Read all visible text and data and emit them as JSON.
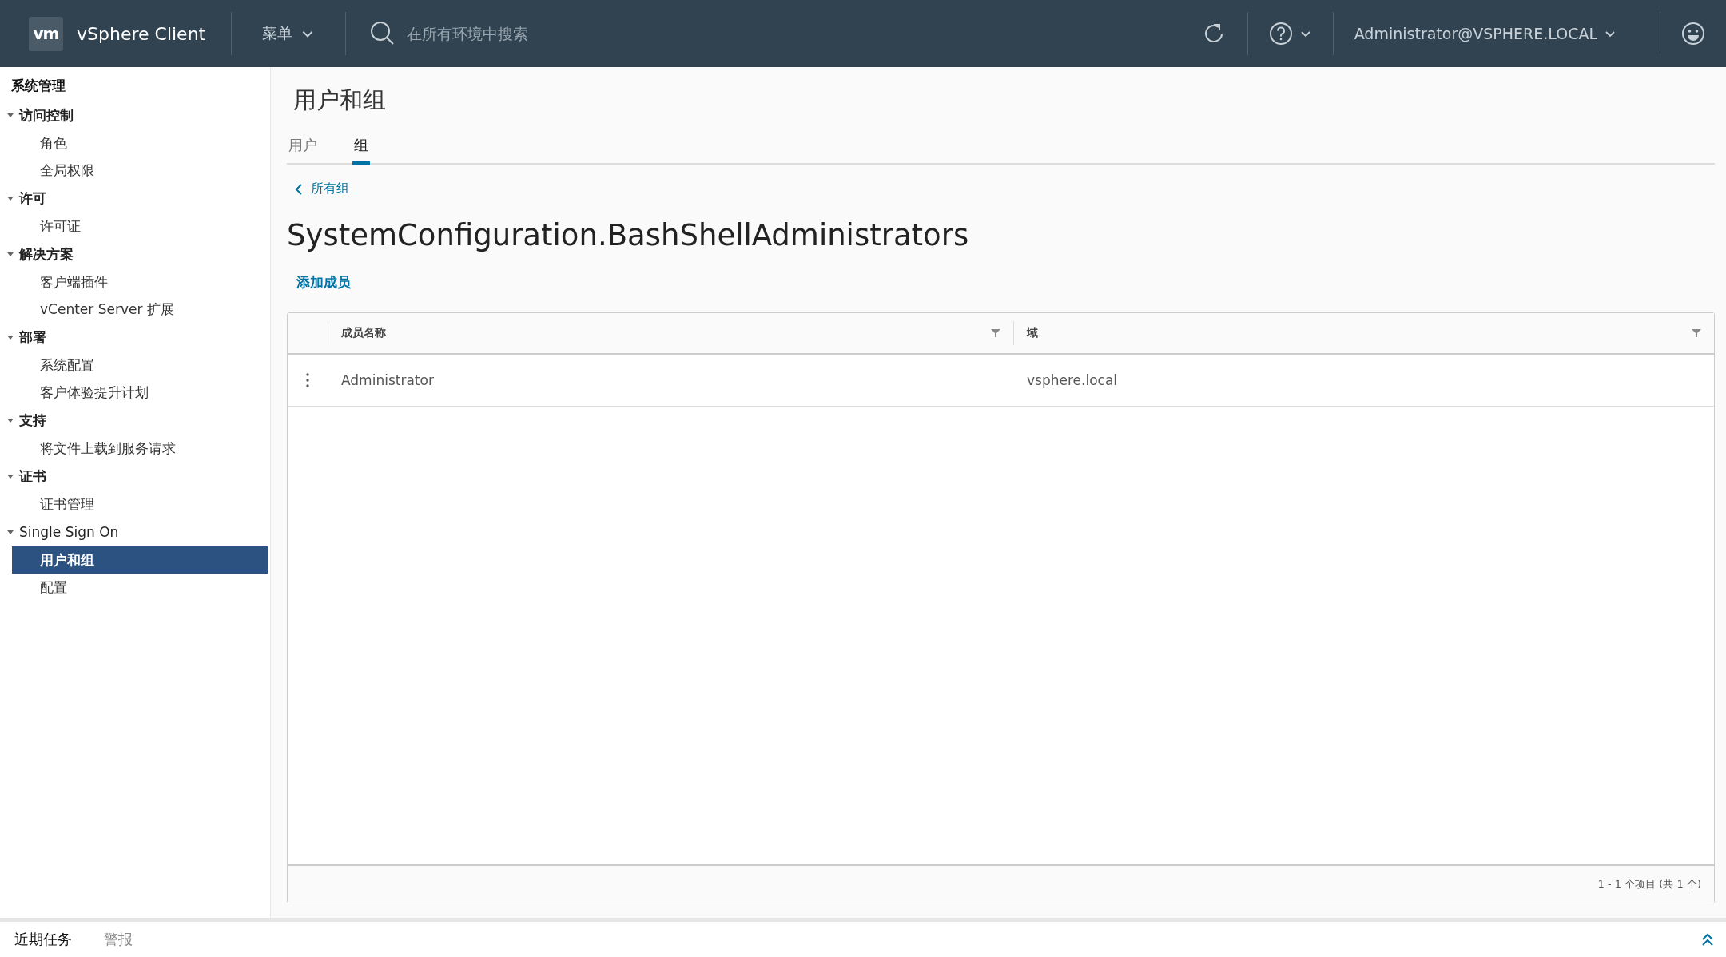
{
  "header": {
    "logo": "vm",
    "app_name": "vSphere Client",
    "menu": "菜单",
    "search": {
      "placeholder": "在所有环境中搜索"
    },
    "user": "Administrator@VSPHERE.LOCAL"
  },
  "sidebar": {
    "title": "系统管理",
    "items": [
      {
        "label": "访问控制",
        "expanded": true,
        "children": [
          {
            "label": "角色",
            "selected": false
          },
          {
            "label": "全局权限",
            "selected": false
          }
        ]
      },
      {
        "label": "许可",
        "expanded": true,
        "children": [
          {
            "label": "许可证",
            "selected": false
          }
        ]
      },
      {
        "label": "解决方案",
        "expanded": true,
        "children": [
          {
            "label": "客户端插件",
            "selected": false
          },
          {
            "label": "vCenter Server 扩展",
            "selected": false
          }
        ]
      },
      {
        "label": "部署",
        "expanded": true,
        "children": [
          {
            "label": "系统配置",
            "selected": false
          },
          {
            "label": "客户体验提升计划",
            "selected": false
          }
        ]
      },
      {
        "label": "支持",
        "expanded": true,
        "children": [
          {
            "label": "将文件上载到服务请求",
            "selected": false
          }
        ]
      },
      {
        "label": "证书",
        "expanded": true,
        "children": [
          {
            "label": "证书管理",
            "selected": false
          }
        ]
      },
      {
        "label": "Single Sign On",
        "expanded": true,
        "children": [
          {
            "label": "用户和组",
            "selected": true
          },
          {
            "label": "配置",
            "selected": false
          }
        ]
      }
    ]
  },
  "page": {
    "title": "用户和组",
    "tabs": [
      {
        "label": "用户",
        "selected": false
      },
      {
        "label": "组",
        "selected": true
      }
    ],
    "back_link": "所有组",
    "group_name": "SystemConfiguration.BashShellAdministrators",
    "add_member": "添加成员"
  },
  "table": {
    "columns": [
      "成员名称",
      "域"
    ],
    "rows": [
      [
        "Administrator",
        "vsphere.local"
      ]
    ],
    "footer": "1 - 1 个项目 (共 1 个)"
  },
  "bottom_tabs": [
    {
      "label": "近期任务",
      "selected": true
    },
    {
      "label": "警报",
      "selected": false
    }
  ]
}
